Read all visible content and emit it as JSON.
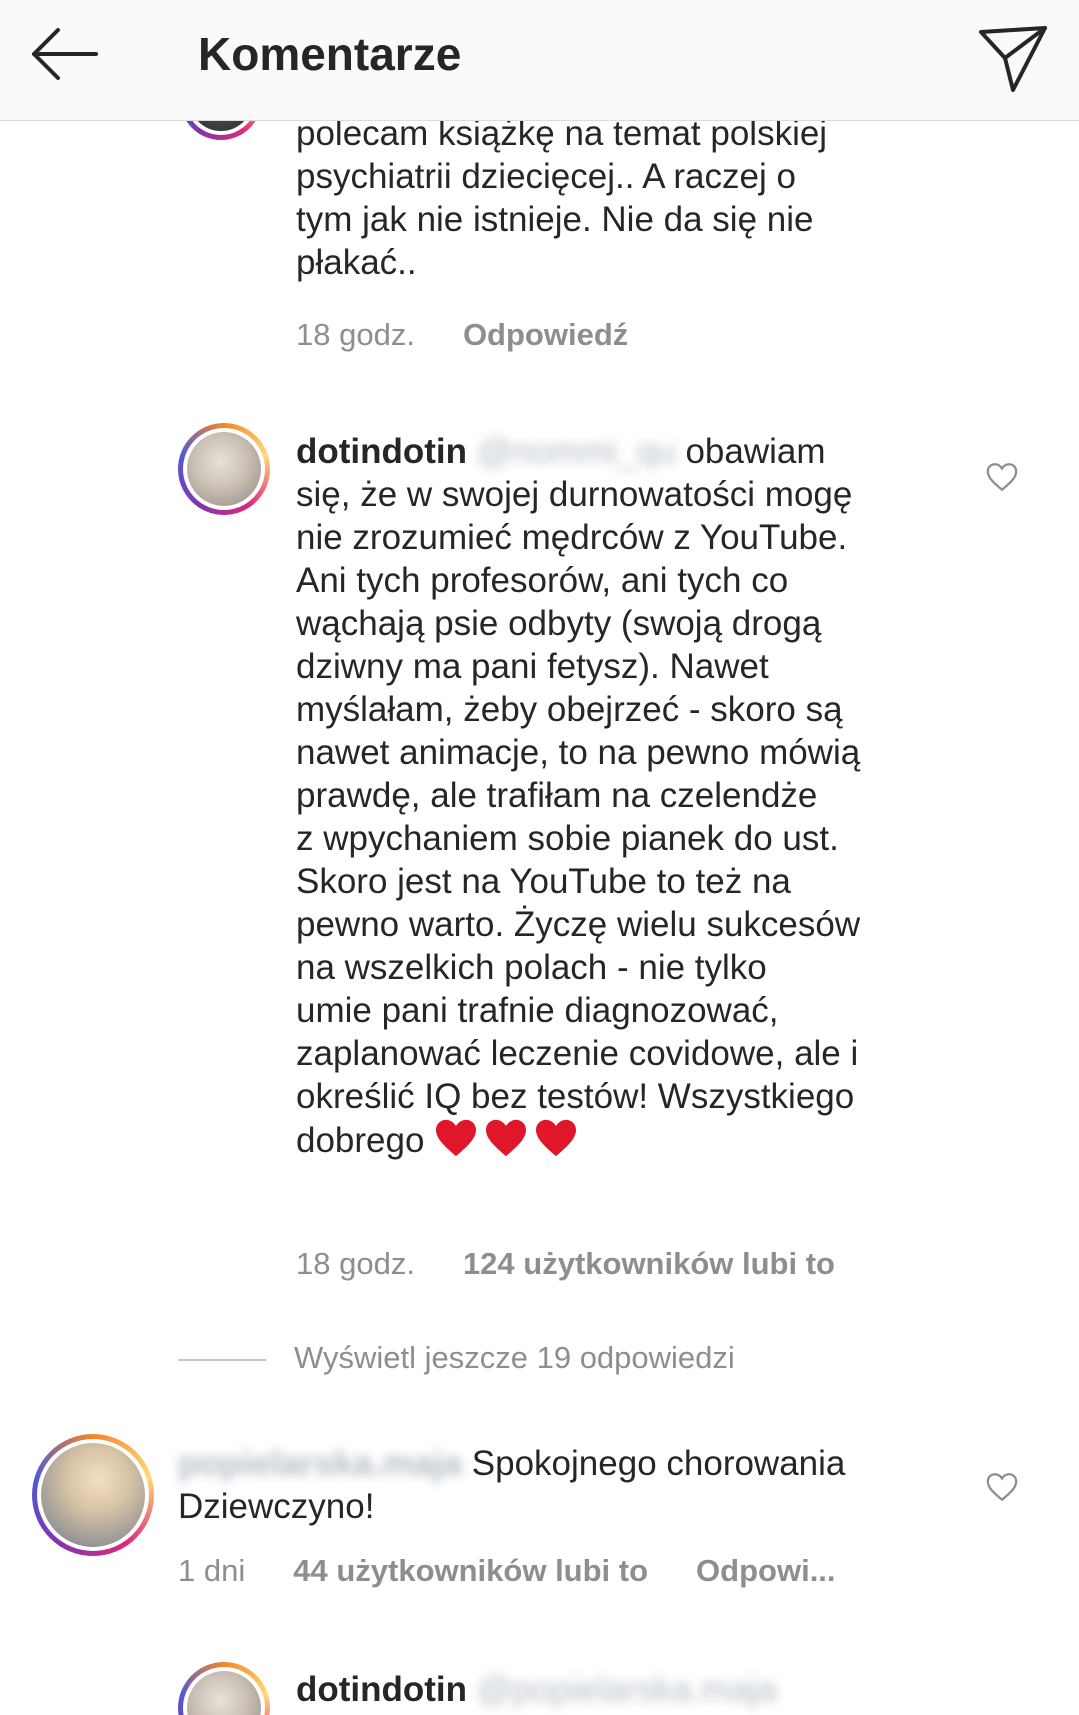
{
  "header": {
    "title": "Komentarze"
  },
  "comments": [
    {
      "text_lines": [
        "polecam książkę na temat polskiej",
        "psychiatrii dziecięcej.. A raczej o",
        "tym jak nie istnieje. Nie da się nie",
        "płakać.."
      ],
      "time": "18 godz.",
      "reply_label": "Odpowiedź"
    },
    {
      "username": "dotindotin",
      "mention": "@nommi_qu",
      "first_line_rest": "obawiam",
      "text_lines": [
        "się, że w swojej durnowatości mogę",
        "nie zrozumieć mędrców z YouTube.",
        "Ani tych profesorów, ani tych co",
        "wąchają psie odbyty (swoją drogą",
        "dziwny ma pani fetysz). Nawet",
        "myślałam, żeby obejrzeć - skoro są",
        "nawet animacje, to na pewno mówią",
        "prawdę, ale trafiłam na czelendże",
        "z wpychaniem sobie pianek do ust.",
        "Skoro jest na YouTube to też na",
        "pewno warto. Życzę wielu sukcesów",
        "na wszelkich polach - nie tylko",
        "umie pani trafnie diagnozować,",
        "zaplanować leczenie covidowe, ale i",
        "określić IQ bez testów! Wszystkiego"
      ],
      "last_line": "dobrego",
      "hearts": "❤❤❤",
      "time": "18 godz.",
      "likes": "124 użytkowników lubi to"
    }
  ],
  "view_replies": "Wyświetl jeszcze 19 odpowiedzi",
  "comment3": {
    "username": "popielarska.maja",
    "text_first": "Spokojnego chorowania",
    "text_second": "Dziewczyno!",
    "time": "1 dni",
    "likes": "44 użytkowników lubi to",
    "reply_label": "Odpowi..."
  },
  "comment4": {
    "username": "dotindotin",
    "mention": "@popielarska.maja"
  },
  "icons": {
    "back": "arrow-left-icon",
    "send": "paper-plane-icon",
    "like": "heart-outline-icon"
  },
  "colors": {
    "text": "#262626",
    "secondary": "#8e8e8e",
    "heart_emoji": "#e0162b"
  }
}
